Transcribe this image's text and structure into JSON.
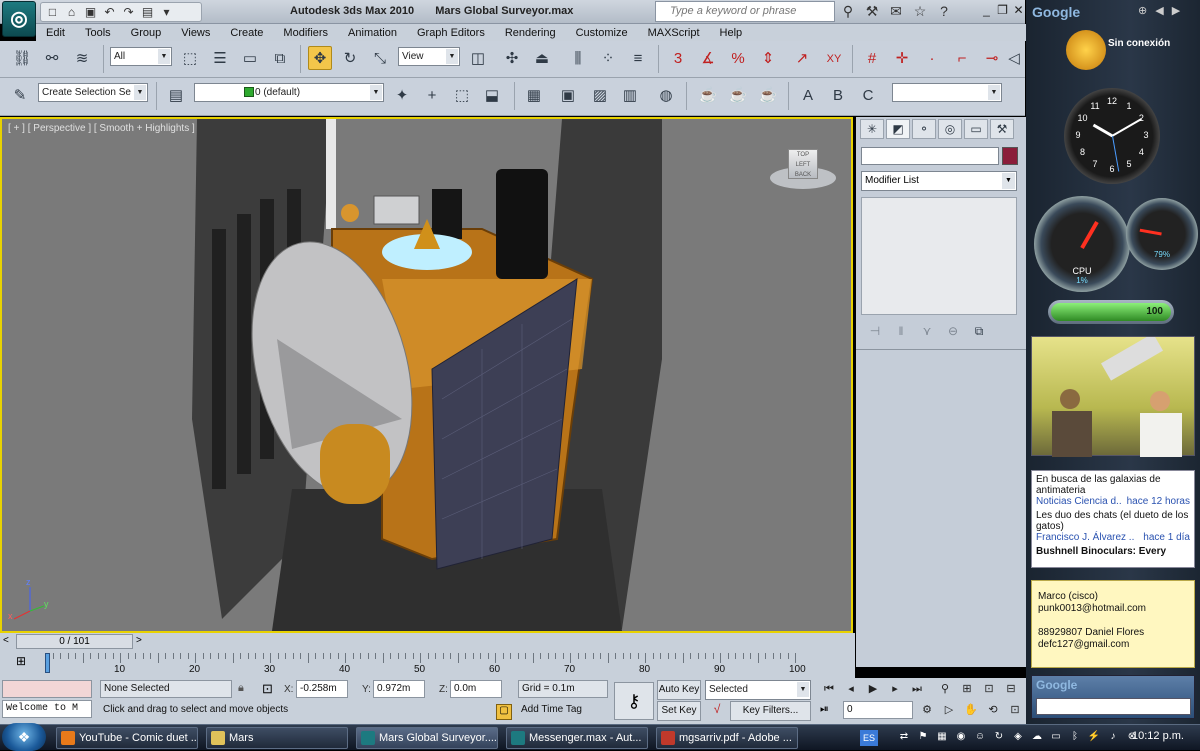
{
  "titlebar": {
    "app_name": "Autodesk 3ds Max  2010",
    "file_name": "Mars Global Surveyor.max",
    "search_placeholder": "Type a keyword or phrase"
  },
  "menu": [
    "Edit",
    "Tools",
    "Group",
    "Views",
    "Create",
    "Modifiers",
    "Animation",
    "Graph Editors",
    "Rendering",
    "Customize",
    "MAXScript",
    "Help"
  ],
  "toolbar1": {
    "selection_filter": "All",
    "ref_coord": "View",
    "snap_labels": [
      "3",
      "%",
      "XY"
    ]
  },
  "toolbar2": {
    "named_selection": "Create Selection Se",
    "layer": "0 (default)",
    "letters": [
      "A",
      "B",
      "C"
    ]
  },
  "viewport": {
    "label": "[ + ] [ Perspective ] [ Smooth + Highlights ]",
    "viewcube_labels": [
      "TOP",
      "LEFT",
      "BACK"
    ],
    "axis": [
      "x",
      "y",
      "z"
    ]
  },
  "command_panel": {
    "modifier_list": "Modifier List"
  },
  "timeline": {
    "frame_display": "0 / 101",
    "ticks": [
      "0",
      "10",
      "20",
      "30",
      "40",
      "50",
      "60",
      "70",
      "80",
      "90",
      "100"
    ]
  },
  "status": {
    "listener": "Welcome to M",
    "selection": "None Selected",
    "prompt": "Click and drag to select and move objects",
    "x_label": "X:",
    "x_value": "-0.258m",
    "y_label": "Y:",
    "y_value": "0.972m",
    "z_label": "Z:",
    "z_value": "0.0m",
    "grid": "Grid = 0.1m",
    "add_time_tag": "Add Time Tag",
    "auto_key": "Auto Key",
    "set_key": "Set Key",
    "key_mode": "Selected",
    "key_filters": "Key Filters...",
    "current_frame": "0"
  },
  "taskbar": {
    "tasks": [
      {
        "label": "YouTube - Comic duet ...",
        "color": "#e87a1a"
      },
      {
        "label": "Mars",
        "color": "#e0c25a"
      },
      {
        "label": "Mars Global Surveyor....",
        "color": "#1d7a80"
      },
      {
        "label": "Messenger.max - Aut...",
        "color": "#1d7a80"
      },
      {
        "label": "mgsarriv.pdf - Adobe ...",
        "color": "#c0392b"
      }
    ],
    "lang": "ES",
    "clock": "10:12 p.m."
  },
  "sidebar": {
    "google_label": "Google",
    "weather_status": "Sin conexión",
    "clock_numbers": [
      "12",
      "1",
      "2",
      "3",
      "4",
      "5",
      "6",
      "7",
      "8",
      "9",
      "10",
      "11"
    ],
    "cpu_label": "CPU",
    "cpu_value": "1%",
    "mem_value": "79%",
    "battery": "100",
    "news": [
      {
        "title": "En busca de las galaxias de antimateria",
        "source": "Noticias Ciencia d..",
        "time": "hace 12 horas"
      },
      {
        "title": "Les duo des chats (el dueto de los gatos)",
        "source": "Francisco J. Álvarez ..",
        "time": "hace 1 día"
      },
      {
        "title": "Bushnell Binoculars: Every",
        "source": "",
        "time": ""
      }
    ],
    "notes": [
      "Marco (cisco)",
      "punk0013@hotmail.com",
      "",
      "88929807 Daniel Flores",
      "defc127@gmail.com"
    ],
    "google_search_label": "Google"
  },
  "colors": {
    "viewport_border": "#e8d200",
    "ui_panel": "#c8d0da",
    "object_color": "#8b1d3a"
  }
}
